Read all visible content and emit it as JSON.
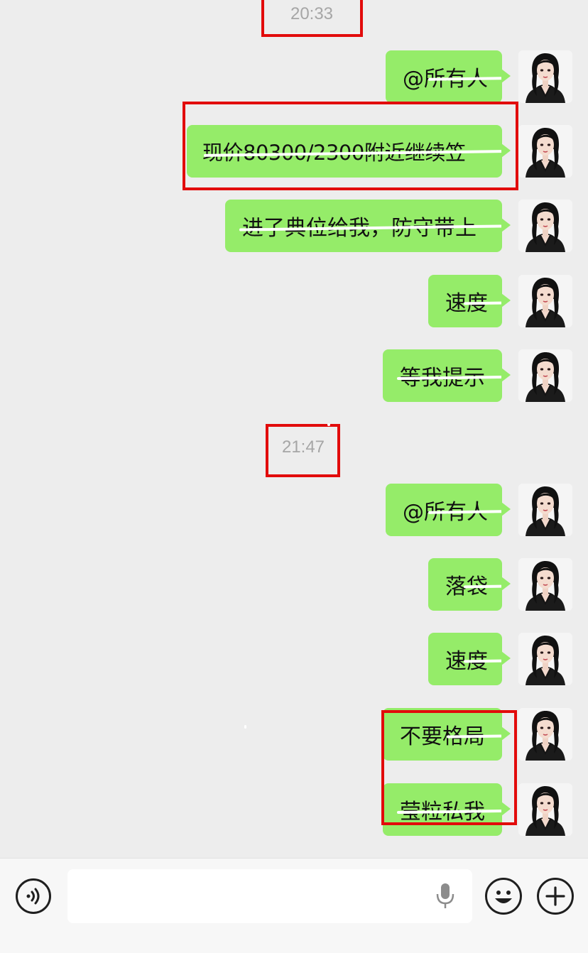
{
  "chat": {
    "groups": [
      {
        "time": "20:33",
        "messages": [
          "@所有人",
          "现价80300/2300附近继续笠",
          "进了典位给我，防守带上",
          "速度",
          "等我提示"
        ]
      },
      {
        "time": "21:47",
        "messages": [
          "@所有人",
          "落袋",
          "速度",
          "不要格局",
          "莹粒私我"
        ]
      }
    ]
  },
  "colors": {
    "bubble": "#95ec69",
    "background": "#ededed",
    "highlight": "#e20b0b",
    "timestamp": "#a6a6a6"
  },
  "input_bar": {
    "voice_icon": "voice-icon",
    "mic_icon": "microphone-icon",
    "emoji_icon": "emoji-icon",
    "plus_icon": "plus-icon"
  }
}
